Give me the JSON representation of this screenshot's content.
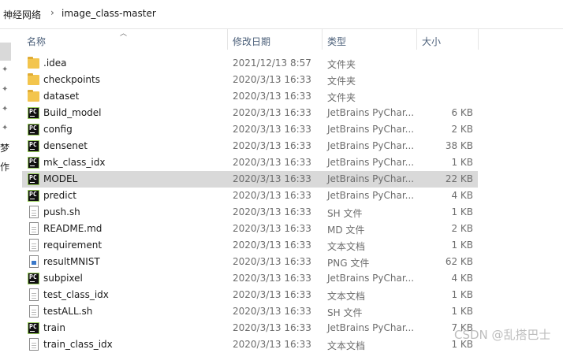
{
  "breadcrumb": [
    "神经网络",
    "image_class-master"
  ],
  "breadcrumb_separator": "›",
  "nav_partial": [
    "梦",
    "作"
  ],
  "columns": {
    "name": "名称",
    "date": "修改日期",
    "type": "类型",
    "size": "大小"
  },
  "files": [
    {
      "name": ".idea",
      "date": "2021/12/13 8:57",
      "type": "文件夹",
      "size": "",
      "icon": "folder-icon"
    },
    {
      "name": "checkpoints",
      "date": "2020/3/13 16:33",
      "type": "文件夹",
      "size": "",
      "icon": "folder-icon"
    },
    {
      "name": "dataset",
      "date": "2020/3/13 16:33",
      "type": "文件夹",
      "size": "",
      "icon": "folder-icon"
    },
    {
      "name": "Build_model",
      "date": "2020/3/13 16:33",
      "type": "JetBrains PyChar...",
      "size": "6 KB",
      "icon": "pycharm-icon"
    },
    {
      "name": "config",
      "date": "2020/3/13 16:33",
      "type": "JetBrains PyChar...",
      "size": "2 KB",
      "icon": "pycharm-icon"
    },
    {
      "name": "densenet",
      "date": "2020/3/13 16:33",
      "type": "JetBrains PyChar...",
      "size": "38 KB",
      "icon": "pycharm-icon"
    },
    {
      "name": "mk_class_idx",
      "date": "2020/3/13 16:33",
      "type": "JetBrains PyChar...",
      "size": "1 KB",
      "icon": "pycharm-icon"
    },
    {
      "name": "MODEL",
      "date": "2020/3/13 16:33",
      "type": "JetBrains PyChar...",
      "size": "22 KB",
      "icon": "pycharm-icon",
      "selected": true
    },
    {
      "name": "predict",
      "date": "2020/3/13 16:33",
      "type": "JetBrains PyChar...",
      "size": "4 KB",
      "icon": "pycharm-icon"
    },
    {
      "name": "push.sh",
      "date": "2020/3/13 16:33",
      "type": "SH 文件",
      "size": "1 KB",
      "icon": "file-icon"
    },
    {
      "name": "README.md",
      "date": "2020/3/13 16:33",
      "type": "MD 文件",
      "size": "2 KB",
      "icon": "file-icon"
    },
    {
      "name": "requirement",
      "date": "2020/3/13 16:33",
      "type": "文本文档",
      "size": "1 KB",
      "icon": "text-file-icon"
    },
    {
      "name": "resultMNIST",
      "date": "2020/3/13 16:33",
      "type": "PNG 文件",
      "size": "62 KB",
      "icon": "png-icon"
    },
    {
      "name": "subpixel",
      "date": "2020/3/13 16:33",
      "type": "JetBrains PyChar...",
      "size": "4 KB",
      "icon": "pycharm-icon"
    },
    {
      "name": "test_class_idx",
      "date": "2020/3/13 16:33",
      "type": "文本文档",
      "size": "1 KB",
      "icon": "text-file-icon"
    },
    {
      "name": "testALL.sh",
      "date": "2020/3/13 16:33",
      "type": "SH 文件",
      "size": "1 KB",
      "icon": "file-icon"
    },
    {
      "name": "train",
      "date": "2020/3/13 16:33",
      "type": "JetBrains PyChar...",
      "size": "7 KB",
      "icon": "pycharm-icon"
    },
    {
      "name": "train_class_idx",
      "date": "2020/3/13 16:33",
      "type": "文本文档",
      "size": "1 KB",
      "icon": "text-file-icon"
    }
  ],
  "watermark": "CSDN @乱搭巴士"
}
